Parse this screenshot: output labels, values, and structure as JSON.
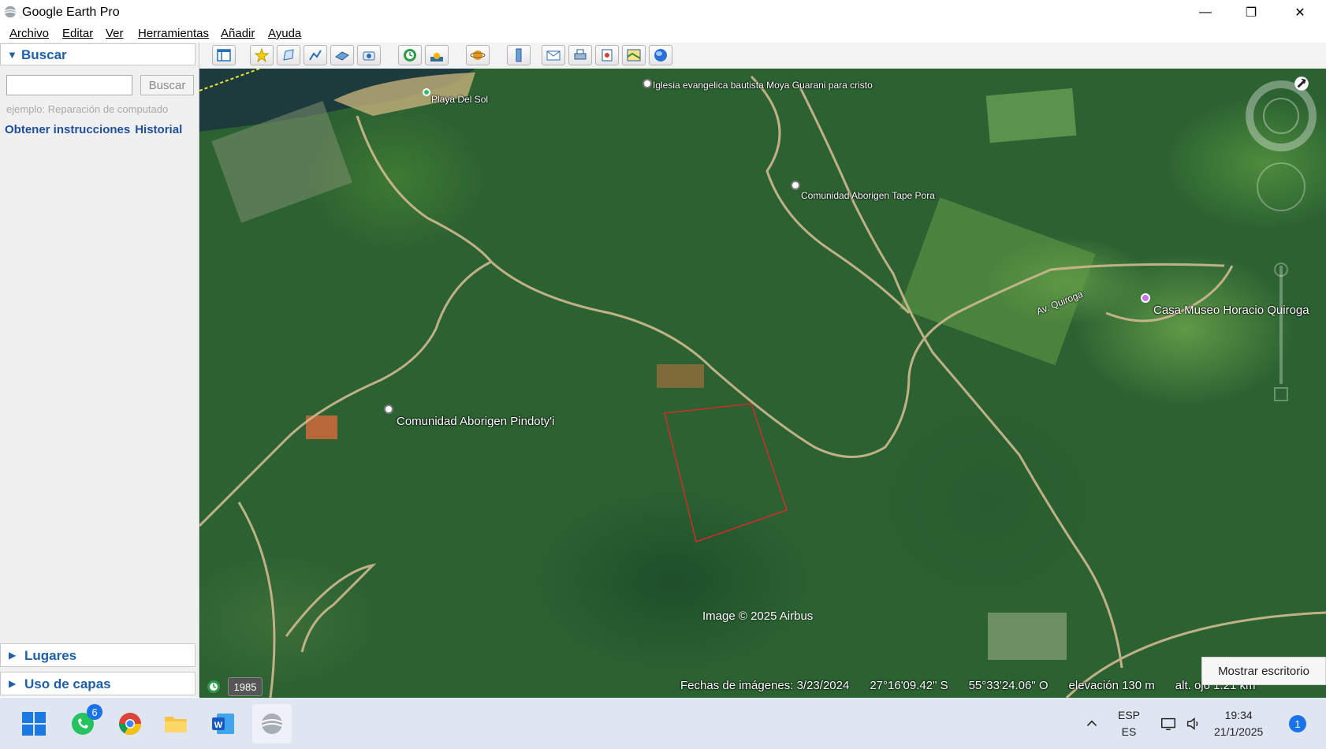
{
  "window": {
    "title": "Google Earth Pro",
    "minimize": "—",
    "restore": "❐",
    "close": "✕"
  },
  "menu": [
    "Archivo",
    "Editar",
    "Ver",
    "Herramientas",
    "Añadir",
    "Ayuda"
  ],
  "search_panel": {
    "header": "Buscar",
    "input_value": "",
    "button_label": "Buscar",
    "example_text": "ejemplo: Reparación de computado",
    "link_directions": "Obtener instrucciones",
    "link_history": "Historial"
  },
  "places_panel": {
    "header": "Lugares"
  },
  "layers_panel": {
    "header": "Uso de capas"
  },
  "map": {
    "labels": {
      "playa": "Playa Del Sol",
      "iglesia": "Iglesia evangelica bautista Moya Guarani para cristo",
      "tape_pora": "Comunidad Aborigen Tape Pora",
      "casa_museo": "Casa Museo Horacio Quiroga",
      "pindoty": "Comunidad Aborigen Pindoty'i",
      "road": "Av. Quiroga"
    },
    "image_credit": "Image © 2025 Airbus",
    "year": "1985",
    "status": {
      "dates": "Fechas de imágenes: 3/23/2024",
      "lat": "27°16'09.42\" S",
      "lon": "55°33'24.06\" O",
      "elevation": "elevación   130 m",
      "eye_alt": "alt. ojo   1.21 km"
    },
    "tooltip": "Mostrar escritorio",
    "colors": {
      "polygon": "#d42a2a",
      "forest": "#2c6232",
      "road": "#c9b58c"
    }
  },
  "taskbar": {
    "whatsapp_badge": "6",
    "lang_top": "ESP",
    "lang_bottom": "ES",
    "time": "19:34",
    "date": "21/1/2025",
    "notification_count": "1"
  }
}
